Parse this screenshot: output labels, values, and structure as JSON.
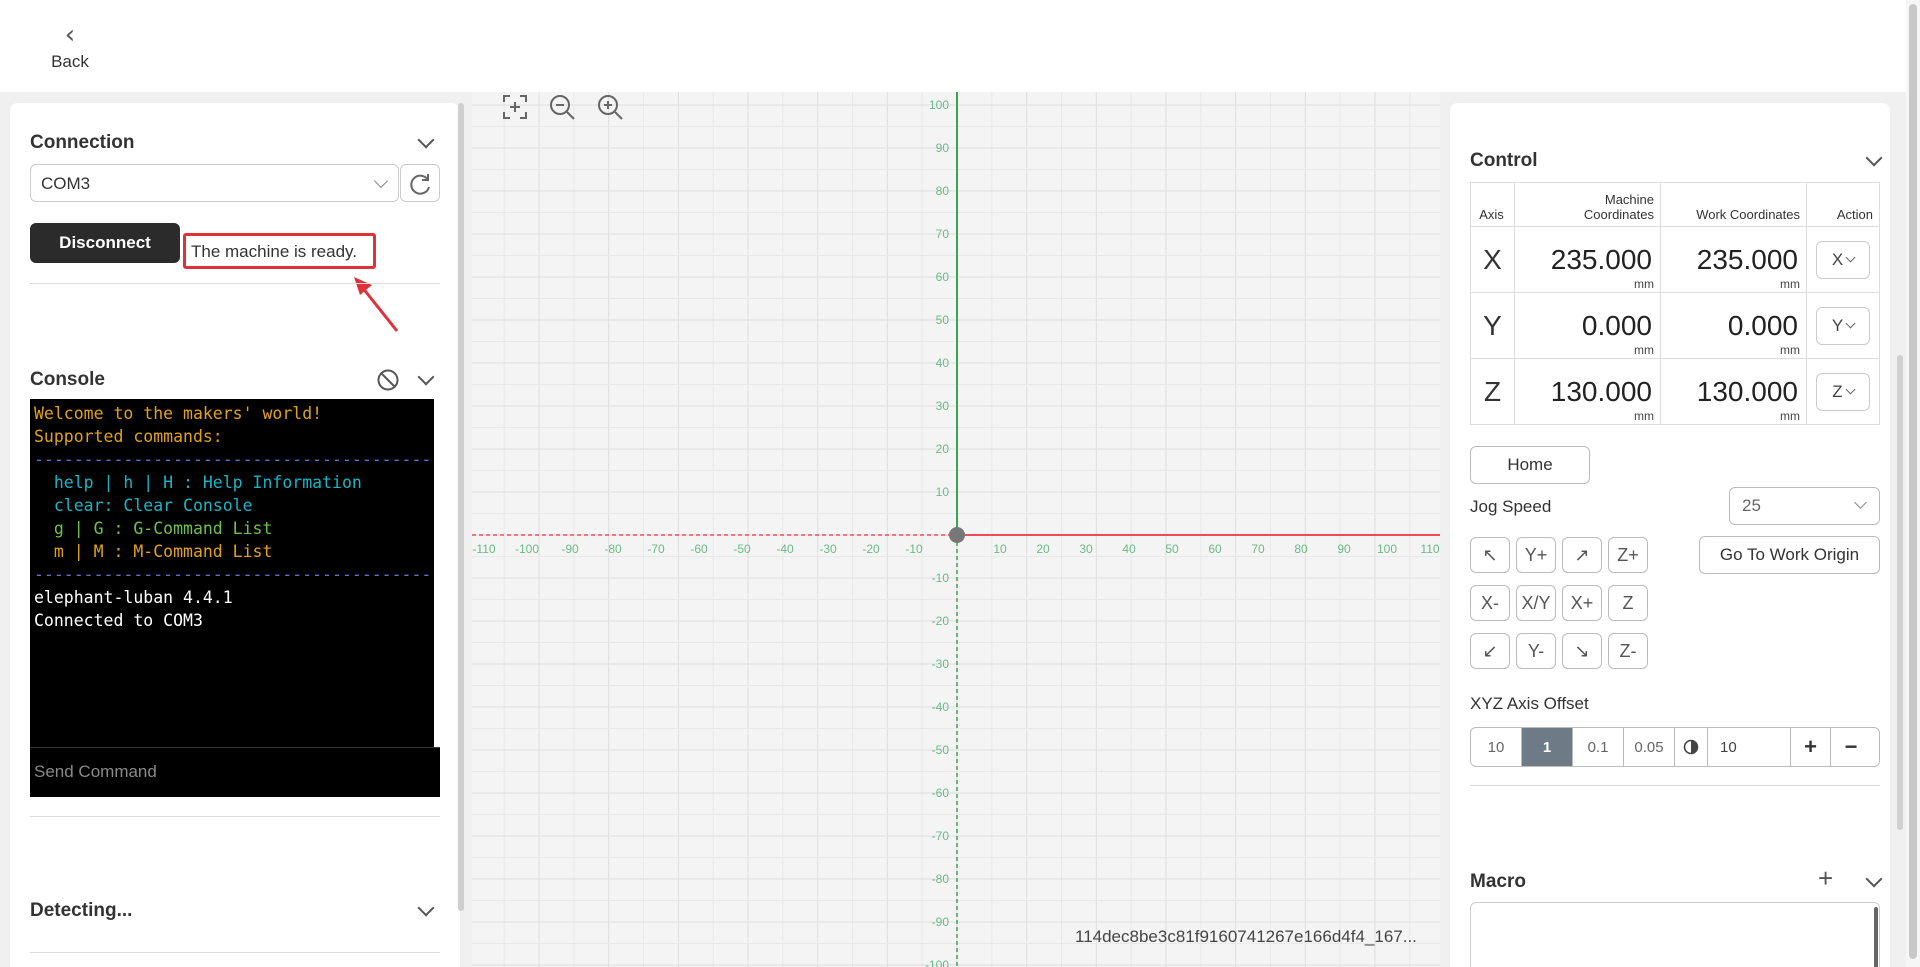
{
  "topbar": {
    "back_label": "Back"
  },
  "connection": {
    "title": "Connection",
    "port": "COM3",
    "disconnect_label": "Disconnect",
    "status": "The machine is ready."
  },
  "console": {
    "title": "Console",
    "lines": [
      {
        "cls": "y",
        "text": "Welcome to the makers' world!"
      },
      {
        "cls": "y",
        "text": "Supported commands:"
      },
      {
        "cls": "b",
        "text": "------------------------------------------"
      },
      {
        "cls": "c",
        "text": "  help | h | H : Help Information"
      },
      {
        "cls": "c",
        "text": "  clear: Clear Console"
      },
      {
        "cls": "g",
        "text": "  g | G : G-Command List"
      },
      {
        "cls": "y",
        "text": "  m | M : M-Command List"
      },
      {
        "cls": "b",
        "text": "------------------------------------------"
      },
      {
        "cls": "w",
        "text": "elephant-luban 4.4.1"
      },
      {
        "cls": "w",
        "text": "Connected to COM3"
      }
    ],
    "send_placeholder": "Send Command"
  },
  "detecting": {
    "title": "Detecting..."
  },
  "canvas": {
    "file_id": "114dec8be3c81f9160741267e166d4f4_167...",
    "x_ticks": [
      "-110",
      "-100",
      "-90",
      "-80",
      "-70",
      "-60",
      "-50",
      "-40",
      "-30",
      "-20",
      "-10",
      "10",
      "20",
      "30",
      "40",
      "50",
      "60",
      "70",
      "80",
      "90",
      "100",
      "110"
    ],
    "y_ticks": [
      "100",
      "90",
      "80",
      "70",
      "60",
      "50",
      "40",
      "30",
      "20",
      "10",
      "-10",
      "-20",
      "-30",
      "-40",
      "-50",
      "-60",
      "-70",
      "-80",
      "-90",
      "-100"
    ]
  },
  "control": {
    "title": "Control",
    "headers": {
      "axis": "Axis",
      "machine_1": "Machine",
      "machine_2": "Coordinates",
      "work": "Work Coordinates",
      "action": "Action"
    },
    "rows": [
      {
        "axis": "X",
        "machine": "235.000",
        "work": "235.000",
        "action": "X",
        "unit": "mm"
      },
      {
        "axis": "Y",
        "machine": "0.000",
        "work": "0.000",
        "action": "Y",
        "unit": "mm"
      },
      {
        "axis": "Z",
        "machine": "130.000",
        "work": "130.000",
        "action": "Z",
        "unit": "mm"
      }
    ],
    "home_label": "Home",
    "jog_speed_label": "Jog Speed",
    "jog_speed_value": "25",
    "go_to_origin_label": "Go To Work Origin",
    "jog": {
      "y_plus": "Y+",
      "z_plus": "Z+",
      "x_minus": "X-",
      "xy": "X/Y",
      "x_plus": "X+",
      "z": "Z",
      "y_minus": "Y-",
      "z_minus": "Z-"
    },
    "offset_label": "XYZ Axis Offset",
    "offset_steps": [
      "10",
      "1",
      "0.1",
      "0.05"
    ],
    "offset_selected": "1",
    "offset_custom": "10"
  },
  "macro": {
    "title": "Macro"
  },
  "colors": {
    "status_border": "#e0313b",
    "x_axis": "#ee4b57",
    "y_axis": "#3aa64c",
    "selected_step": "#6e7b87"
  }
}
